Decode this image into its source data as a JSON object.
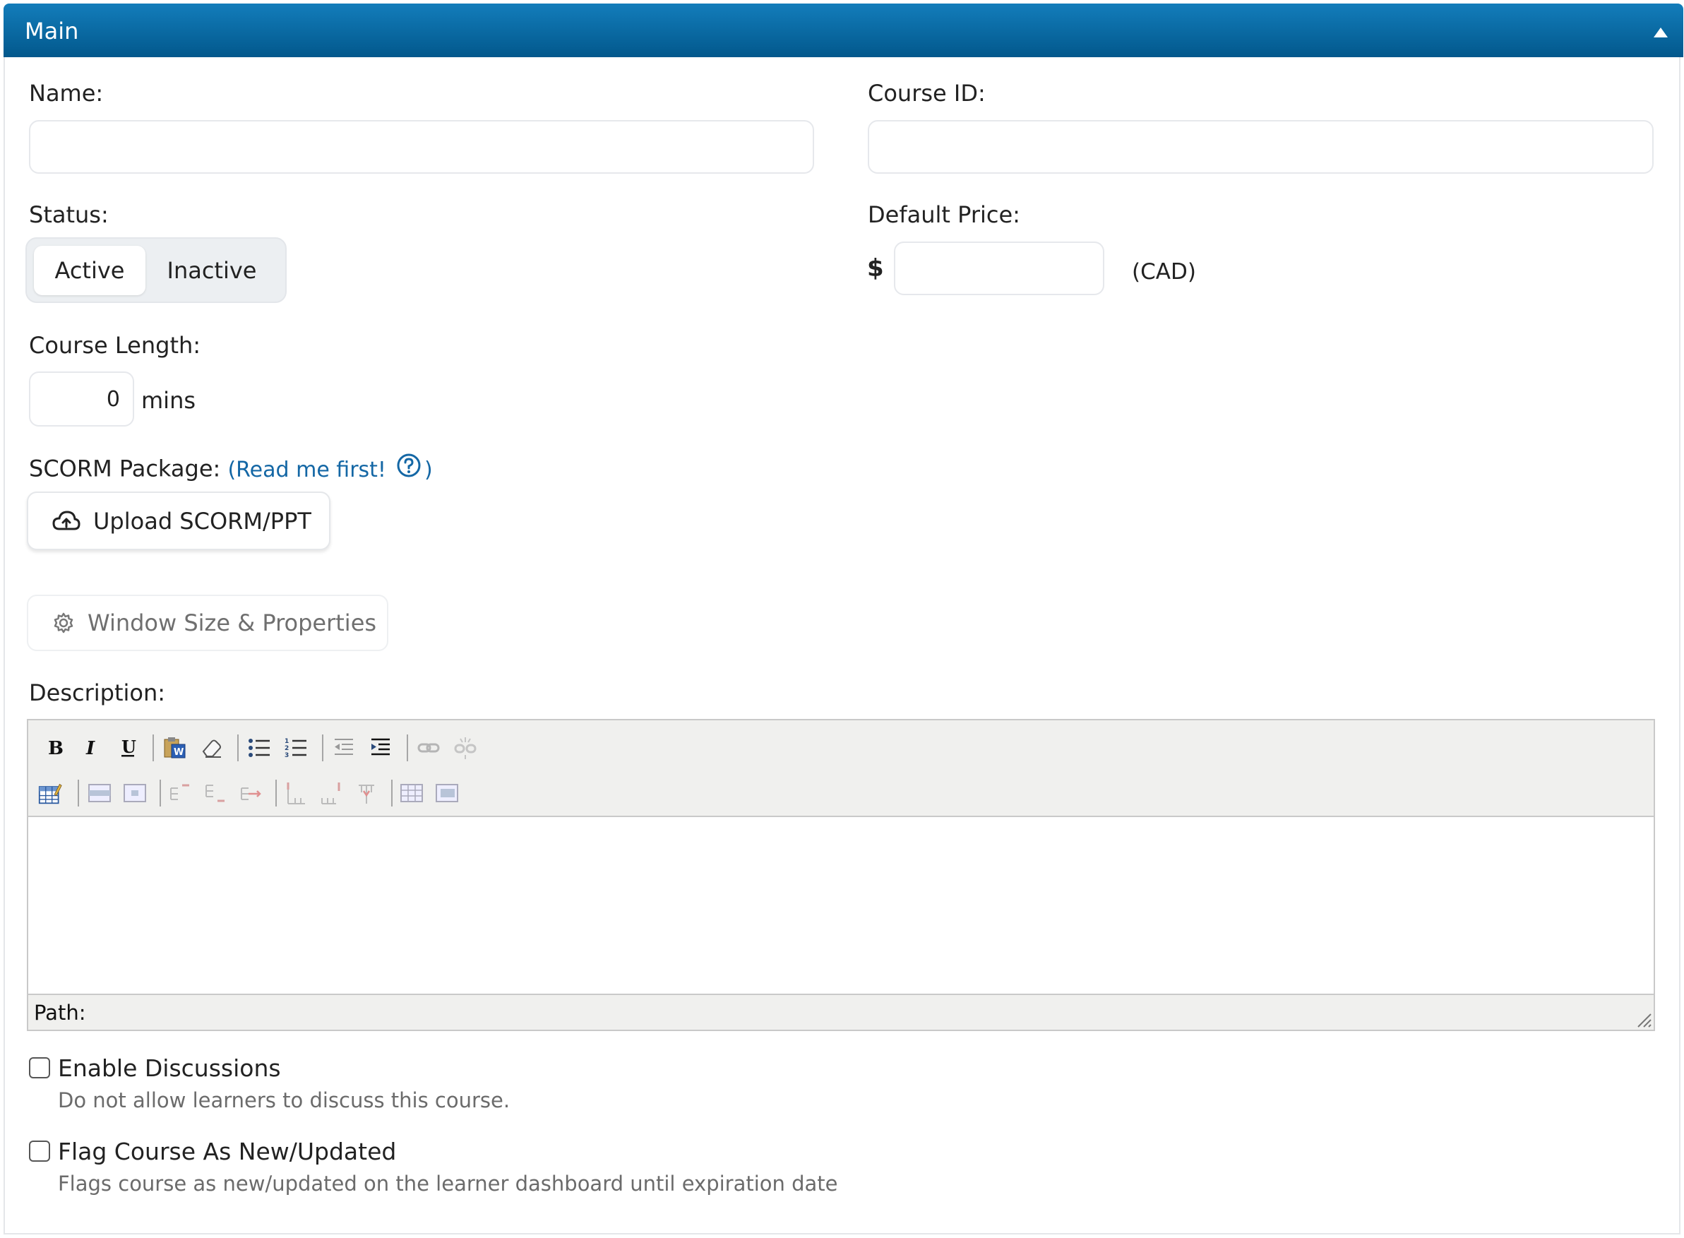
{
  "panel": {
    "title": "Main",
    "collapse_icon": "triangle-up-icon"
  },
  "form": {
    "name_label": "Name:",
    "name_value": "",
    "course_id_label": "Course ID:",
    "course_id_value": "",
    "status_label": "Status:",
    "status_options": [
      "Active",
      "Inactive"
    ],
    "status_selected": "Active",
    "default_price_label": "Default Price:",
    "currency_symbol": "$",
    "price_value": "",
    "currency_code": "(CAD)",
    "course_length_label": "Course Length:",
    "course_length_value": "0",
    "course_length_unit": "mins",
    "scorm_label": "SCORM Package:",
    "scorm_link_open": "(",
    "scorm_link_text": "Read me first!",
    "scorm_link_close": ")",
    "upload_button": "Upload SCORM/PPT",
    "window_button": "Window Size & Properties",
    "description_label": "Description:"
  },
  "editor": {
    "toolbar_row1": [
      "bold",
      "italic",
      "underline",
      "paste-from-word",
      "clean-up",
      "unordered-list",
      "ordered-list",
      "outdent",
      "indent",
      "link",
      "unlink"
    ],
    "toolbar_row2": [
      "insert-table",
      "table-row-props",
      "table-cell-props",
      "insert-row-before",
      "insert-row-after",
      "delete-row",
      "insert-col-before",
      "insert-col-after",
      "delete-col",
      "split-cells",
      "merge-cells"
    ],
    "path_label": "Path:"
  },
  "options": [
    {
      "label": "Enable Discussions",
      "help": "Do not allow learners to discuss this course.",
      "checked": false
    },
    {
      "label": "Flag Course As New/Updated",
      "help": "Flags course as new/updated on the learner dashboard until expiration date",
      "checked": false
    }
  ]
}
